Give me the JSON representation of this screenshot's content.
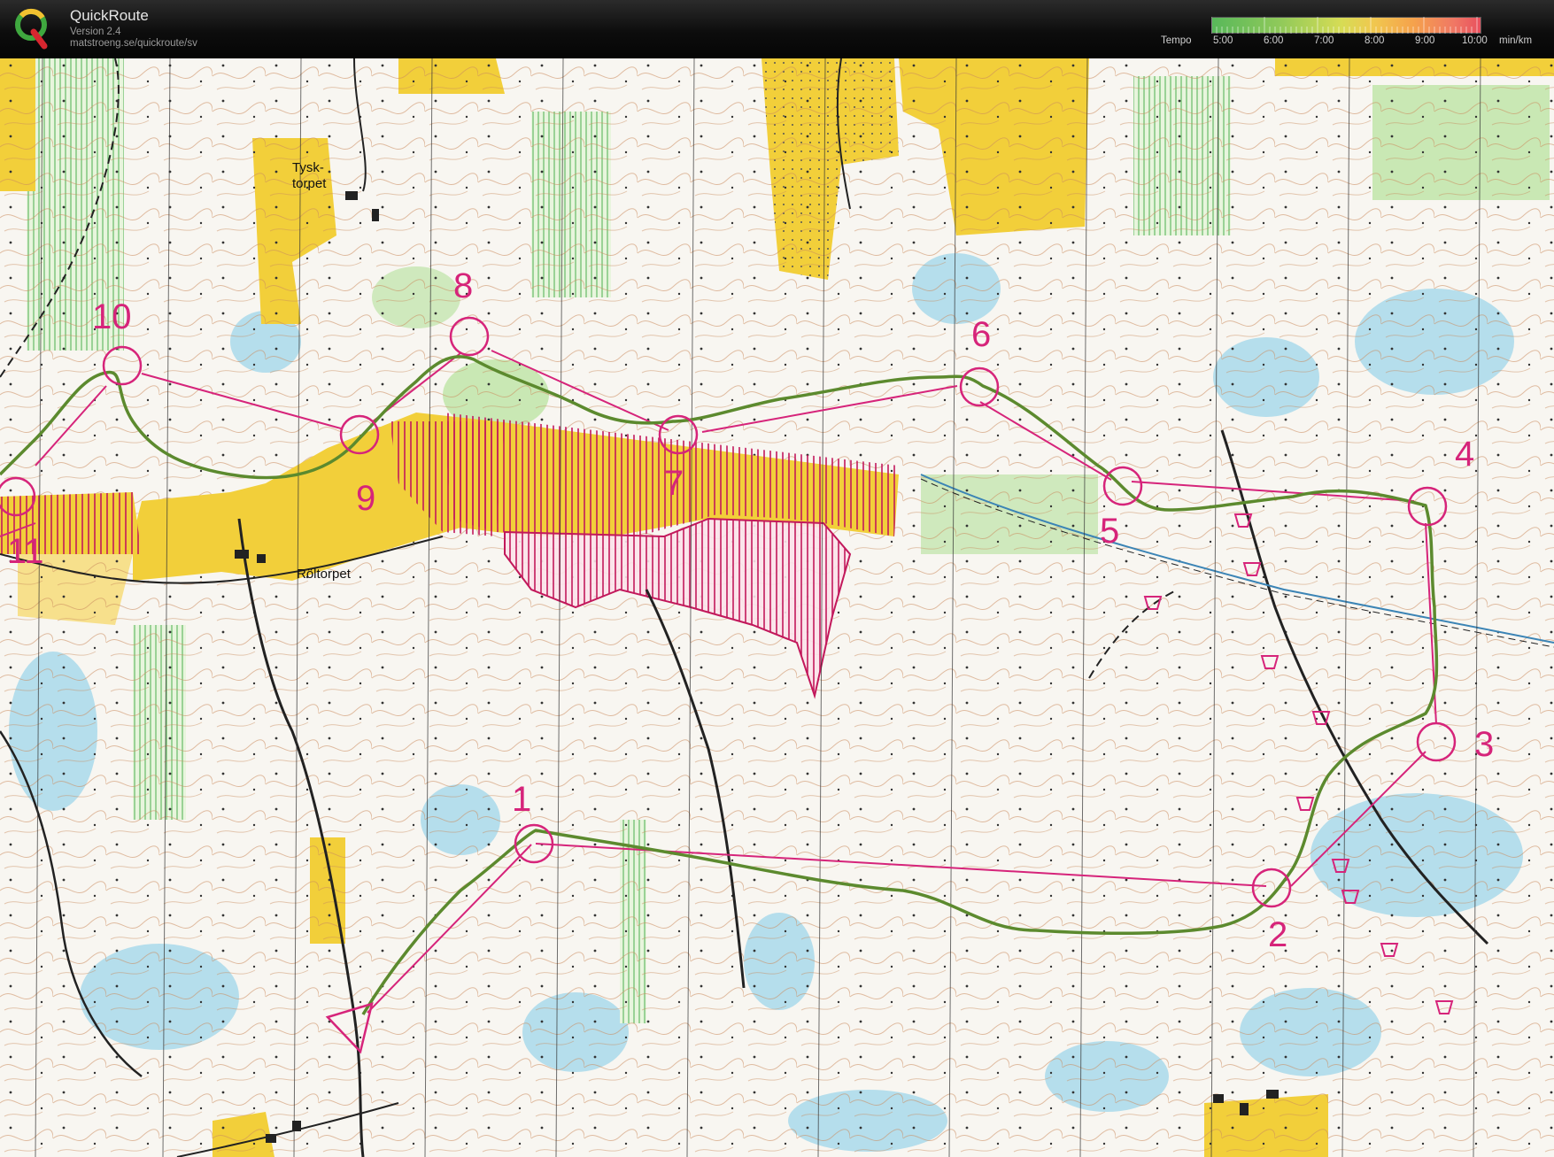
{
  "app": {
    "title": "QuickRoute",
    "version": "Version 2.4",
    "url": "matstroeng.se/quickroute/sv"
  },
  "tempo_legend": {
    "label": "Tempo",
    "ticks": [
      "5:00",
      "6:00",
      "7:00",
      "8:00",
      "9:00",
      "10:00"
    ],
    "unit": "min/km",
    "gradient_colors": [
      "#58b85a",
      "#d6dc55",
      "#f5a24c",
      "#e8505e"
    ]
  },
  "map": {
    "place_names": [
      "Tysk-",
      "torpet",
      "Röltorpet"
    ],
    "controls": [
      "1",
      "2",
      "3",
      "4",
      "5",
      "6",
      "7",
      "8",
      "9",
      "10",
      "11"
    ],
    "colors": {
      "course": "#d6247a",
      "route": "#5c8a2e",
      "forest": "#f7f4ef",
      "open_land": "#f2cf3a",
      "marsh": "#8fd0e8",
      "green": "#bde2a8",
      "contour": "#c77d4a",
      "forbidden": "#c2185b"
    }
  }
}
